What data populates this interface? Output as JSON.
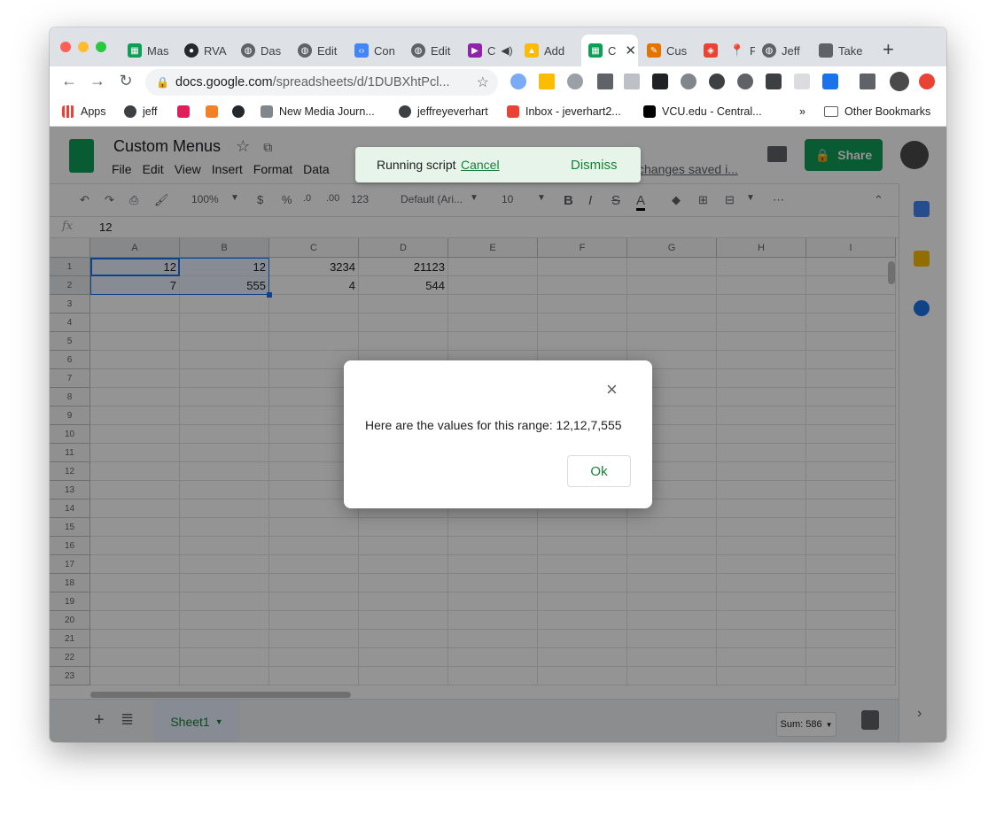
{
  "browser": {
    "tabs": [
      {
        "label": "Mas",
        "icon": "sheets-icon"
      },
      {
        "label": "RVA",
        "icon": "github-icon"
      },
      {
        "label": "Das",
        "icon": "globe-icon"
      },
      {
        "label": "Edit",
        "icon": "globe-icon"
      },
      {
        "label": "Con",
        "icon": "code-icon"
      },
      {
        "label": "Edit",
        "icon": "globe-icon"
      },
      {
        "label": "C",
        "icon": "flag-icon"
      },
      {
        "label": "Add",
        "icon": "drive-icon"
      },
      {
        "label": "C",
        "icon": "sheets-icon"
      },
      {
        "label": "Cus",
        "icon": "brush-icon"
      },
      {
        "label": "",
        "icon": "shield-icon"
      },
      {
        "label": "F",
        "icon": "pin-icon"
      },
      {
        "label": "Jeff",
        "icon": "globe-icon"
      },
      {
        "label": "Take",
        "icon": "apple-icon"
      }
    ],
    "url_host": "docs.google.com",
    "url_path": "/spreadsheets/d/1DUBXhtPcl...",
    "bookmarks": [
      {
        "label": "Apps"
      },
      {
        "label": "jeff"
      },
      {
        "label": ""
      },
      {
        "label": ""
      },
      {
        "label": ""
      },
      {
        "label": "New Media Journ..."
      },
      {
        "label": "jeffreyeverhart"
      },
      {
        "label": "Inbox - jeverhart2..."
      },
      {
        "label": "VCU.edu - Central..."
      }
    ],
    "more_bookmarks": "»",
    "other_bookmarks": "Other Bookmarks"
  },
  "doc": {
    "title": "Custom Menus",
    "menu": [
      "File",
      "Edit",
      "View",
      "Insert",
      "Format",
      "Data"
    ],
    "saved_status": "changes saved i...",
    "share_label": "Share"
  },
  "toolbar": {
    "zoom": "100%",
    "currency": "$",
    "percent": "%",
    "dec_less": ".0",
    "dec_more": ".00",
    "format_more": "123",
    "font": "Default (Ari...",
    "font_size": "10",
    "bold": "B",
    "italic": "I",
    "strike": "S",
    "text_color": "A"
  },
  "formula_bar": {
    "fx": "fx",
    "value": "12"
  },
  "grid": {
    "columns": [
      "A",
      "B",
      "C",
      "D",
      "E",
      "F",
      "G",
      "H",
      "I"
    ],
    "rows": [
      "1",
      "2",
      "3",
      "4",
      "5",
      "6",
      "7",
      "8",
      "9",
      "10",
      "11",
      "12",
      "13",
      "14",
      "15",
      "16",
      "17",
      "18",
      "19",
      "20",
      "21",
      "22",
      "23"
    ],
    "cells": [
      [
        "12",
        "12",
        "3234",
        "21123"
      ],
      [
        "7",
        "555",
        "4",
        "544"
      ]
    ]
  },
  "bottom": {
    "sheet_name": "Sheet1",
    "sum": "Sum: 586"
  },
  "toast": {
    "message": "Running script",
    "cancel": "Cancel",
    "dismiss": "Dismiss"
  },
  "dialog": {
    "message": "Here are the values for this range: 12,12,7,555",
    "ok_label": "Ok",
    "close": "×"
  },
  "colors": {
    "sheets_green": "#0f9d58",
    "link_green": "#188038",
    "toast_bg": "#e6f4ea"
  }
}
